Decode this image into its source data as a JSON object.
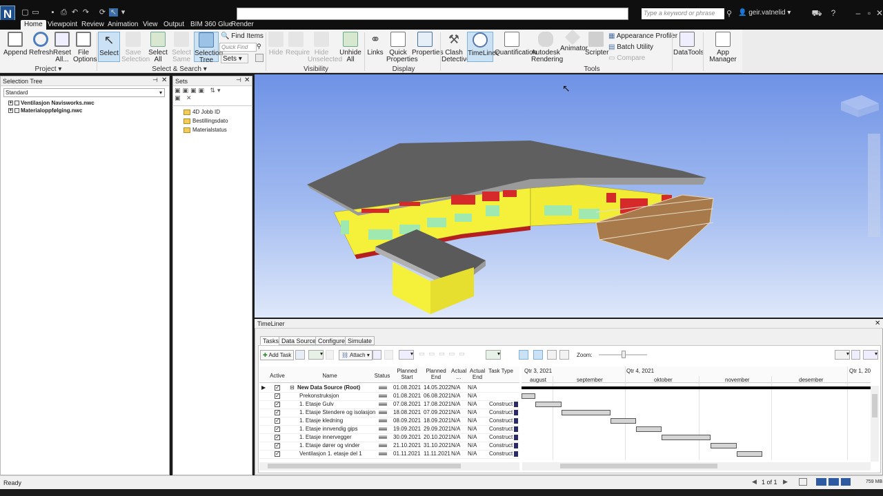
{
  "titlebar": {
    "search_placeholder": "Type a keyword or phrase",
    "user": "geir.vatnelid"
  },
  "tabs": [
    "Home",
    "Viewpoint",
    "Review",
    "Animation",
    "View",
    "Output",
    "BIM 360 Glue",
    "Render"
  ],
  "ribbon": {
    "project": {
      "append": "Append",
      "refresh": "Refresh",
      "reset_all": "Reset All...",
      "file_options": "File Options",
      "group": "Project"
    },
    "select": {
      "select": "Select",
      "save_selection": "Save Selection",
      "select_all": "Select All",
      "select_same": "Select Same",
      "selection_tree": "Selection Tree",
      "find_items": "Find Items",
      "quick_find": "Quick Find",
      "sets": "Sets",
      "group": "Select & Search"
    },
    "visibility": {
      "hide": "Hide",
      "require": "Require",
      "hide_unselected": "Hide Unselected",
      "unhide_all": "Unhide All",
      "group": "Visibility"
    },
    "display": {
      "links": "Links",
      "quick_properties": "Quick Properties",
      "properties": "Properties",
      "group": "Display"
    },
    "tools": {
      "clash_detective": "Clash Detective",
      "timeliner": "TimeLiner",
      "quantification": "Quantification",
      "autodesk_rendering": "Autodesk Rendering",
      "animator": "Animator",
      "scripter": "Scripter",
      "appearance_profiler": "Appearance Profiler",
      "batch_utility": "Batch Utility",
      "compare": "Compare",
      "group": "Tools"
    },
    "datatools": "DataTools",
    "app_manager": "App Manager"
  },
  "selection_tree": {
    "title": "Selection Tree",
    "mode": "Standard",
    "items": [
      "Ventilasjon Navisworks.nwc",
      "Materialoppfølging.nwc"
    ]
  },
  "sets": {
    "title": "Sets",
    "items": [
      "4D Jobb ID",
      "Bestillingsdato",
      "Materialstatus"
    ]
  },
  "timeliner": {
    "title": "TimeLiner",
    "tabs": [
      "Tasks",
      "Data Sources",
      "Configure",
      "Simulate"
    ],
    "add_task": "Add Task",
    "attach": "Attach",
    "zoom": "Zoom:",
    "columns": [
      "Active",
      "Name",
      "Status",
      "Planned Start",
      "Planned End",
      "Actual ...",
      "Actual End",
      "Task Type"
    ],
    "quarters": [
      "Qtr 3, 2021",
      "Qtr 4, 2021",
      "Qtr 1, 20"
    ],
    "months": [
      "august",
      "september",
      "oktober",
      "november",
      "desember"
    ],
    "rows": [
      {
        "name": "New Data Source (Root)",
        "start": "01.08.2021",
        "end": "14.05.2022",
        "a_start": "N/A",
        "a_end": "N/A",
        "type": "",
        "bold": true
      },
      {
        "name": "Prekonstruksjon",
        "start": "01.08.2021",
        "end": "06.08.2021",
        "a_start": "N/A",
        "a_end": "N/A",
        "type": ""
      },
      {
        "name": "1. Etasje Gulv",
        "start": "07.08.2021",
        "end": "17.08.2021",
        "a_start": "N/A",
        "a_end": "N/A",
        "type": "Construct"
      },
      {
        "name": "1. Etasje Stendere og isolasjon",
        "start": "18.08.2021",
        "end": "07.09.2021",
        "a_start": "N/A",
        "a_end": "N/A",
        "type": "Construct"
      },
      {
        "name": "1. Etasje kledning",
        "start": "08.09.2021",
        "end": "18.09.2021",
        "a_start": "N/A",
        "a_end": "N/A",
        "type": "Construct"
      },
      {
        "name": "1. Etasje innvendig gips",
        "start": "19.09.2021",
        "end": "29.09.2021",
        "a_start": "N/A",
        "a_end": "N/A",
        "type": "Construct"
      },
      {
        "name": "1. Etasje innervegger",
        "start": "30.09.2021",
        "end": "20.10.2021",
        "a_start": "N/A",
        "a_end": "N/A",
        "type": "Construct"
      },
      {
        "name": "1. Etasje dører og vinder",
        "start": "21.10.2021",
        "end": "31.10.2021",
        "a_start": "N/A",
        "a_end": "N/A",
        "type": "Construct"
      },
      {
        "name": "Ventilasjon 1. etasje del 1",
        "start": "01.11.2021",
        "end": "11.11.2021",
        "a_start": "N/A",
        "a_end": "N/A",
        "type": "Construct"
      }
    ]
  },
  "statusbar": {
    "left": "Ready",
    "page": "1 of 1",
    "memory": "759 MB"
  },
  "colors": {
    "wall": "#f5f03a",
    "roof": "#6e6e6e",
    "window_frame": "#d62a2a",
    "glass": "#9fe8b0",
    "sky_top": "#6f92e6"
  }
}
